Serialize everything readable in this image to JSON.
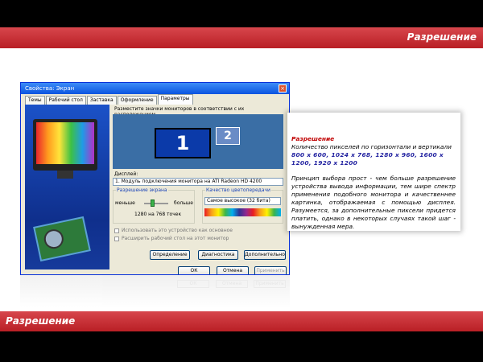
{
  "slide": {
    "header_title": "Разрешение",
    "footer_title": "Разрешение"
  },
  "dialog": {
    "title": "Свойства: Экран",
    "close_label": "×",
    "tabs": [
      "Темы",
      "Рабочий стол",
      "Заставка",
      "Оформление",
      "Параметры"
    ],
    "active_tab": "Параметры",
    "hint": "Разместите значки мониторов в соответствии с их расположением.",
    "monitor1_label": "1",
    "monitor2_label": "2",
    "display_label": "Дисплей:",
    "display_value": "1. Модуль подключения монитора на ATI Radeon HD 4200",
    "resolution_group": "Разрешение экрана",
    "slider_less": "меньше",
    "slider_more": "больше",
    "resolution_value": "1280 на 768 точек",
    "resolution_fraction": 0.35,
    "color_group": "Качество цветопередачи",
    "color_value": "Самое высокое (32 бита)",
    "checkbox_primary": "Использовать это устройство как основное",
    "checkbox_extend": "Расширить рабочий стол на этот монитор",
    "btn_troubleshoot": "Определение",
    "btn_diagnostics": "Диагностика",
    "btn_advanced": "Дополнительно",
    "btn_ok": "ОК",
    "btn_cancel": "Отмена",
    "btn_apply": "Применить"
  },
  "info": {
    "title": "Разрешение",
    "description": "Количество пикселей по горизонтали и вертикали",
    "values": "800 x 600, 1024 x 768, 1280 x 960, 1600 x 1200, 1920 x 1200",
    "principle": "Принцип выбора прост - чем больше разрешение устройства вывода информации, тем шире спектр применения подобного монитора и качественнее картинка, отображаемая с помощью дисплея. Разумеется, за дополнительные пиксели придется платить, однако в некоторых случаях такой шаг - вынужденная мера."
  },
  "colors": {
    "accent_red": "#c62a30",
    "xp_blue": "#0a54e0",
    "title_red": "#c00000",
    "values_blue": "#1f1f9f"
  }
}
